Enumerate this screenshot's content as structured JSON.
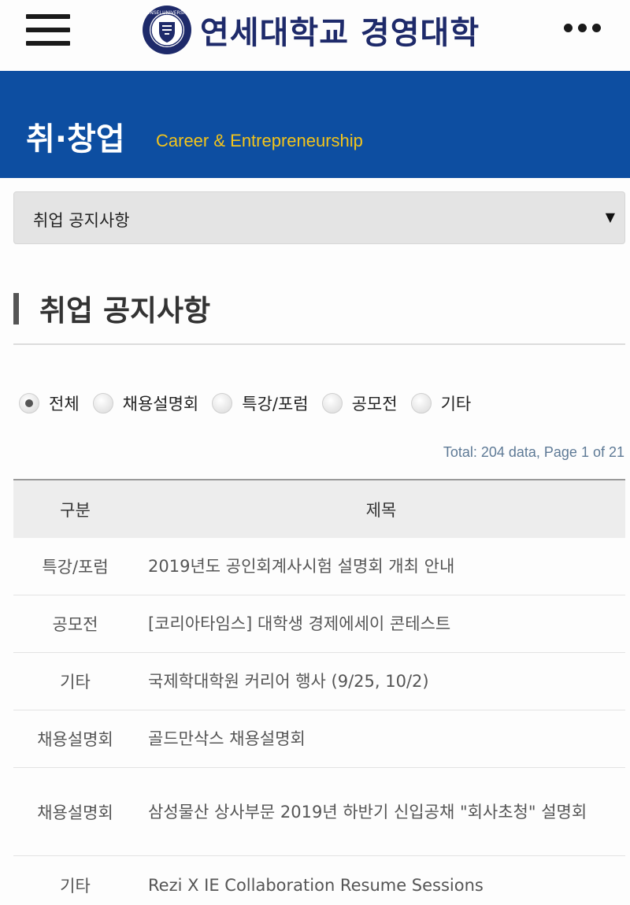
{
  "header": {
    "brand": "연세대학교 경영대학",
    "seal_text": "YONSEI UNIVERSITY",
    "menu_icon": "hamburger-icon",
    "more_icon": "more-dots-icon"
  },
  "banner": {
    "title": "취·창업",
    "subtitle": "Career & Entrepreneurship",
    "bg_color": "#0d4ea1",
    "subtitle_color": "#f3c41b"
  },
  "select": {
    "value": "취업 공지사항",
    "caret": "▼"
  },
  "section": {
    "heading": "취업 공지사항"
  },
  "filters": [
    {
      "label": "전체",
      "checked": true
    },
    {
      "label": "채용설명회",
      "checked": false
    },
    {
      "label": "특강/포럼",
      "checked": false
    },
    {
      "label": "공모전",
      "checked": false
    },
    {
      "label": "기타",
      "checked": false
    }
  ],
  "summary": {
    "total": "Total: 204 data, Page 1 of 21"
  },
  "table": {
    "columns": [
      "구분",
      "제목"
    ],
    "rows": [
      {
        "category": "특강/포럼",
        "title": "2019년도 공인회계사시험 설명회 개최 안내"
      },
      {
        "category": "공모전",
        "title": "[코리아타임스] 대학생 경제에세이 콘테스트"
      },
      {
        "category": "기타",
        "title": "국제학대학원 커리어 행사 (9/25, 10/2)"
      },
      {
        "category": "채용설명회",
        "title": "골드만삭스 채용설명회"
      },
      {
        "category": "채용설명회",
        "title": "삼성물산 상사부문 2019년 하반기 신입공채 \"회사초청\" 설명회"
      },
      {
        "category": "기타",
        "title": "Rezi X IE Collaboration Resume Sessions"
      }
    ]
  }
}
